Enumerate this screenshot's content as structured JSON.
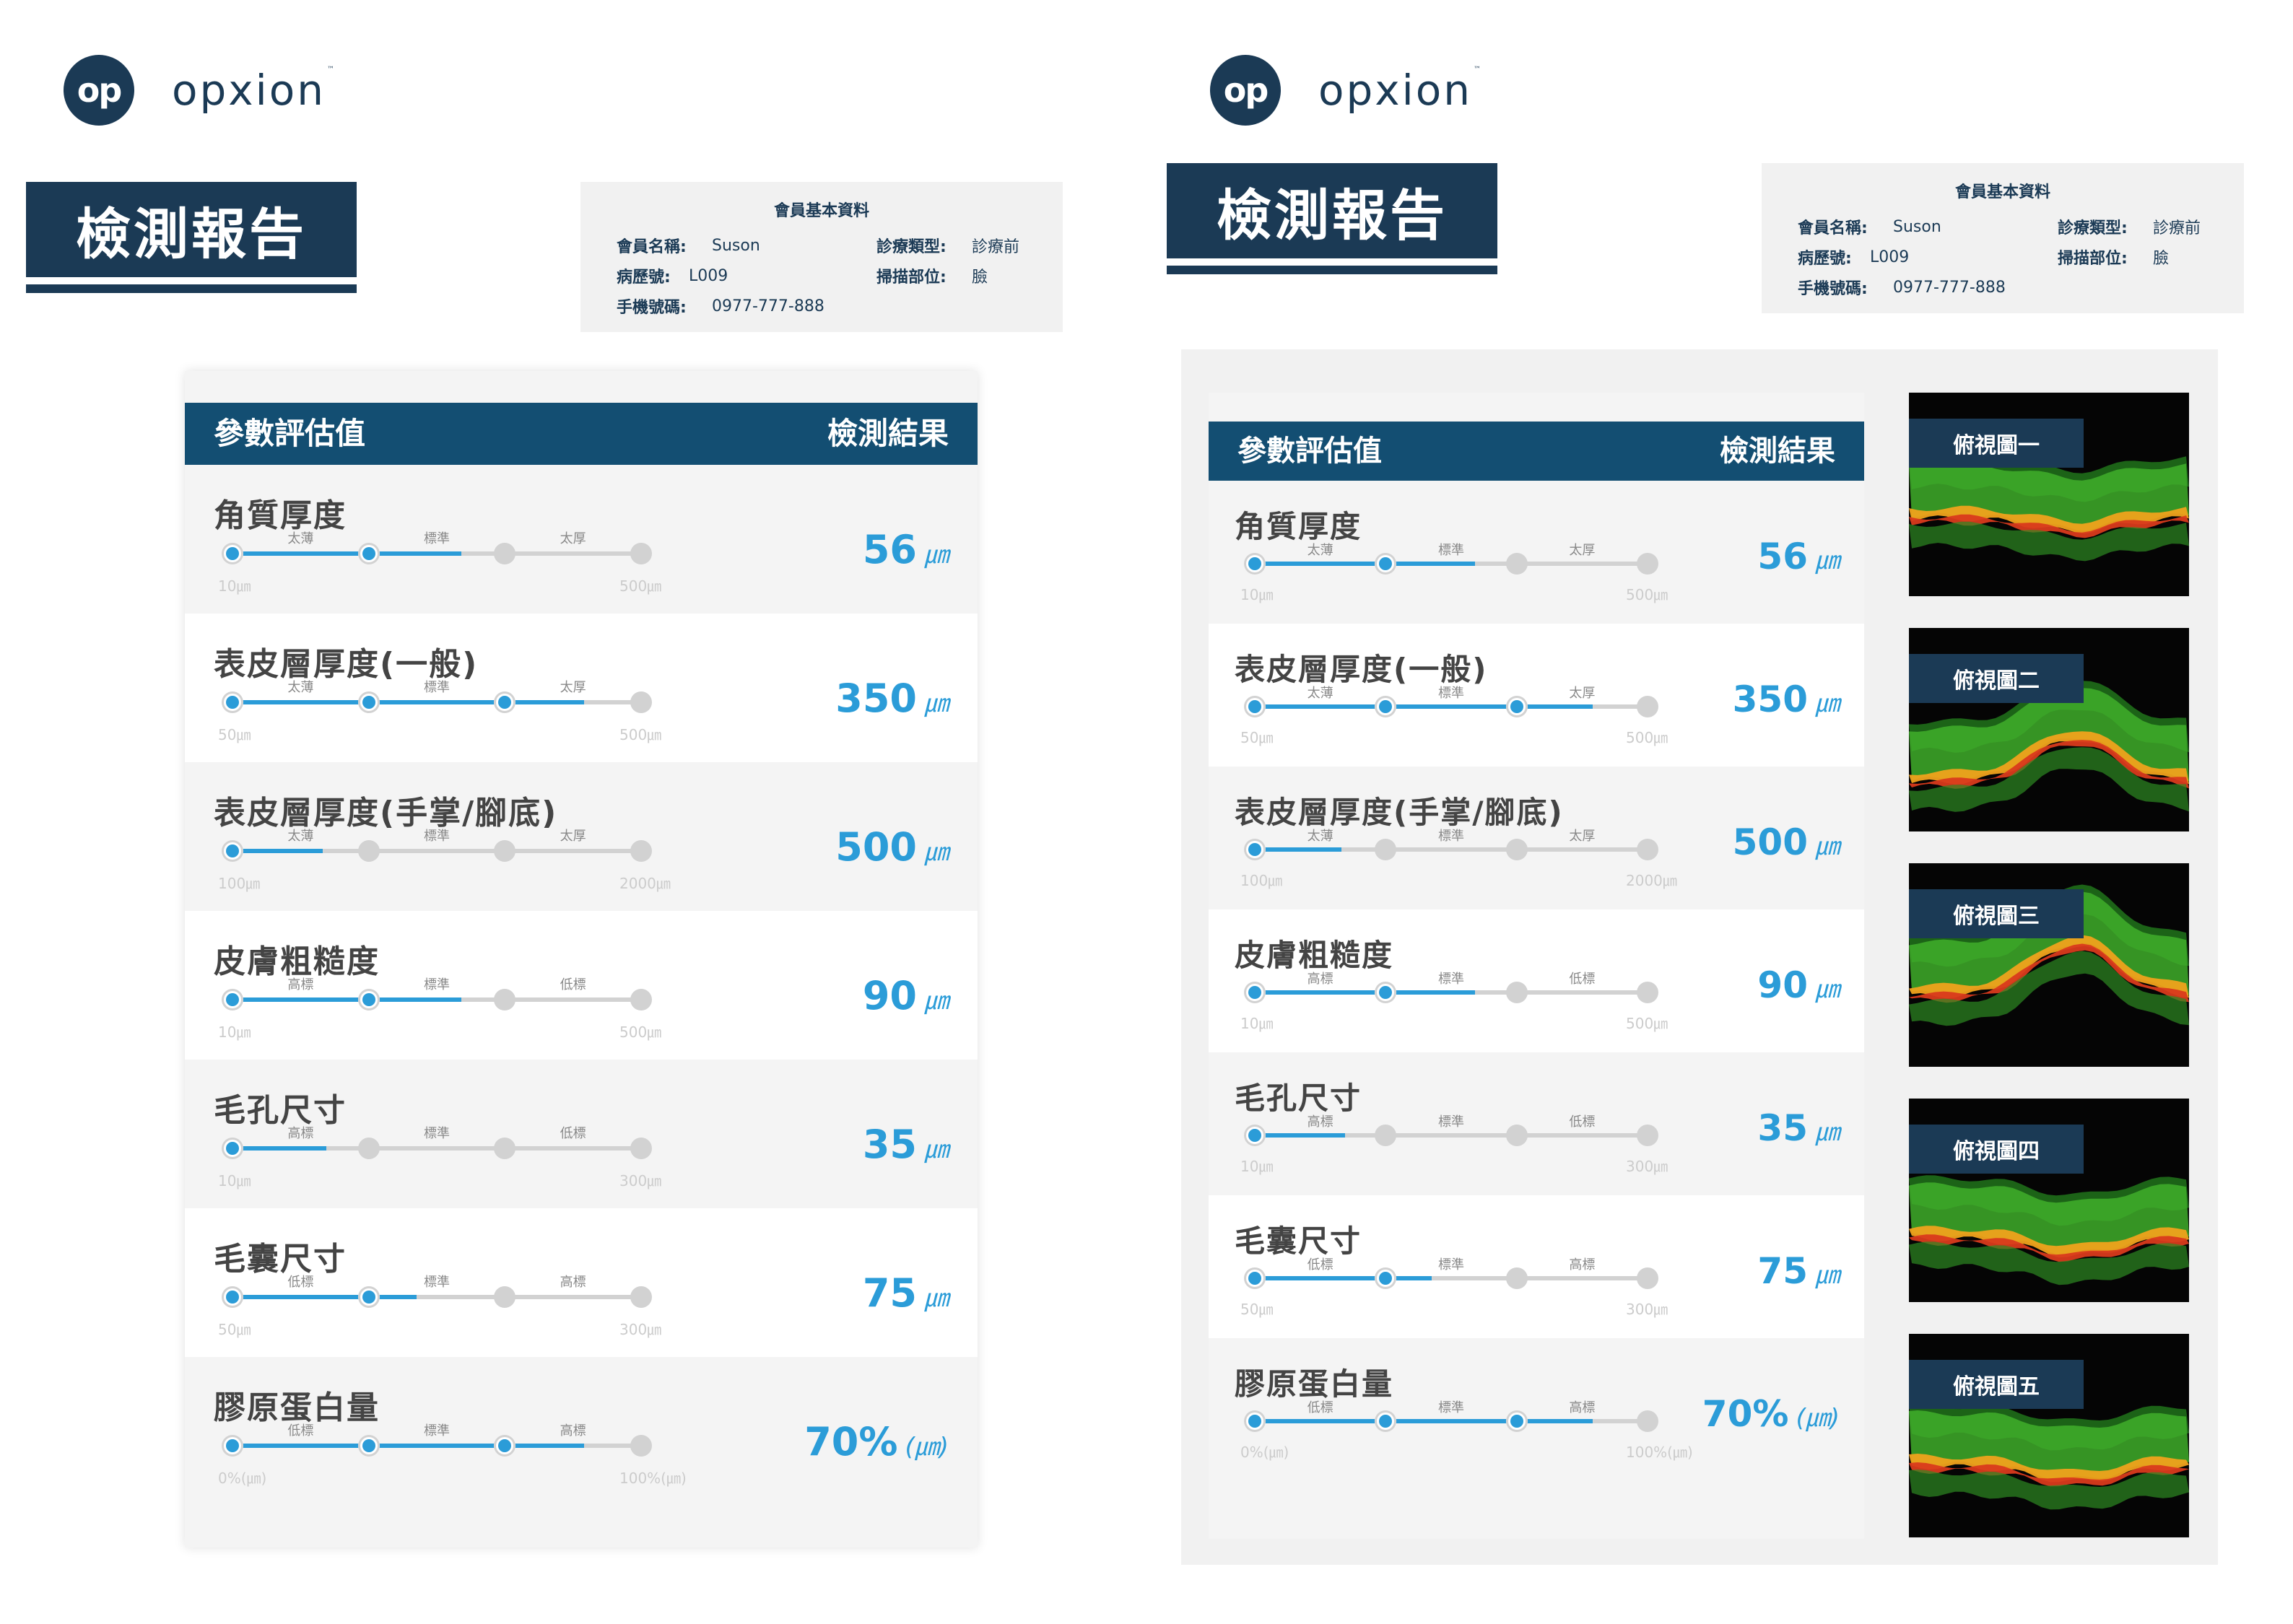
{
  "brand": {
    "mark": "op",
    "name": "opxion",
    "tm": "™"
  },
  "report": {
    "title": "檢測報告"
  },
  "member": {
    "heading": "會員基本資料",
    "name_label": "會員名稱:",
    "name_value": "Suson",
    "record_label": "病歷號:",
    "record_value": "L009",
    "phone_label": "手機號碼:",
    "phone_value": "0977-777-888",
    "type_label": "診療類型:",
    "type_value": "診療前",
    "area_label": "掃描部位:",
    "area_value": "臉"
  },
  "results": {
    "header_left": "參數評估值",
    "header_right": "檢測結果",
    "colors": {
      "accent": "#2b9cd8",
      "header": "#134e72",
      "brand": "#1b3a55"
    },
    "rows": [
      {
        "name": "角質厚度",
        "ticks": [
          "太薄",
          "標準",
          "太厚"
        ],
        "min": "10㎛",
        "max": "500㎛",
        "active_dots": 2,
        "fill_pct": 56,
        "value": "56",
        "unit": "㎛"
      },
      {
        "name": "表皮層厚度(一般)",
        "ticks": [
          "太薄",
          "標準",
          "太厚"
        ],
        "min": "50㎛",
        "max": "500㎛",
        "active_dots": 3,
        "fill_pct": 86,
        "value": "350",
        "unit": "㎛"
      },
      {
        "name": "表皮層厚度(手掌/腳底)",
        "ticks": [
          "太薄",
          "標準",
          "太厚"
        ],
        "min": "100㎛",
        "max": "2000㎛",
        "active_dots": 1,
        "fill_pct": 22,
        "value": "500",
        "unit": "㎛"
      },
      {
        "name": "皮膚粗糙度",
        "ticks": [
          "高標",
          "標準",
          "低標"
        ],
        "min": "10㎛",
        "max": "500㎛",
        "active_dots": 2,
        "fill_pct": 56,
        "value": "90",
        "unit": "㎛"
      },
      {
        "name": "毛孔尺寸",
        "ticks": [
          "高標",
          "標準",
          "低標"
        ],
        "min": "10㎛",
        "max": "300㎛",
        "active_dots": 1,
        "fill_pct": 23,
        "value": "35",
        "unit": "㎛"
      },
      {
        "name": "毛囊尺寸",
        "ticks": [
          "低標",
          "標準",
          "高標"
        ],
        "min": "50㎛",
        "max": "300㎛",
        "active_dots": 2,
        "fill_pct": 45,
        "value": "75",
        "unit": "㎛"
      },
      {
        "name": "膠原蛋白量",
        "ticks": [
          "低標",
          "標準",
          "高標"
        ],
        "min": "0%(㎛)",
        "max": "100%(㎛)",
        "active_dots": 3,
        "fill_pct": 86,
        "value": "70%",
        "unit": "(㎛)"
      }
    ]
  },
  "views": [
    {
      "label": "俯視圖一"
    },
    {
      "label": "俯視圖二"
    },
    {
      "label": "俯視圖三"
    },
    {
      "label": "俯視圖四"
    },
    {
      "label": "俯視圖五"
    }
  ]
}
